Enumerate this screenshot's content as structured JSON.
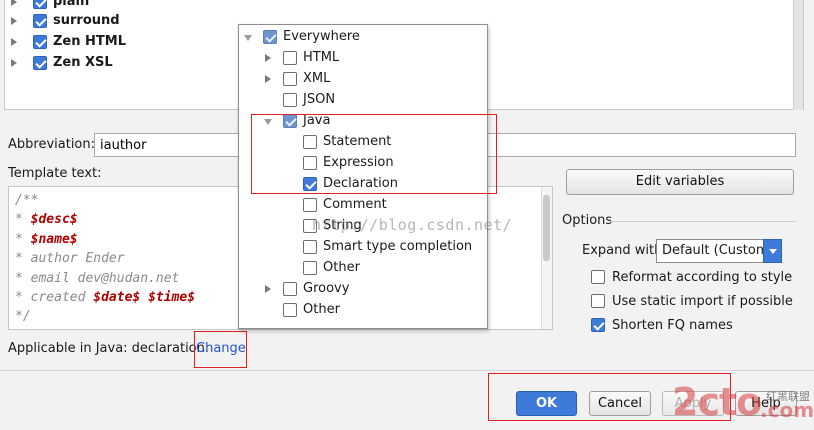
{
  "tree": {
    "items": [
      {
        "label": "plain",
        "checked": true
      },
      {
        "label": "surround",
        "checked": true
      },
      {
        "label": "Zen HTML",
        "checked": true
      },
      {
        "label": "Zen XSL",
        "checked": true
      }
    ]
  },
  "abbreviation": {
    "label": "Abbreviation:",
    "value": "iauthor"
  },
  "template": {
    "label": "Template text:",
    "lines": [
      {
        "prefix": "/**",
        "var": "",
        "rest": ""
      },
      {
        "prefix": " * ",
        "var": "$desc$",
        "rest": ""
      },
      {
        "prefix": " * ",
        "var": "$name$",
        "rest": ""
      },
      {
        "prefix": " * author Ender",
        "var": "",
        "rest": ""
      },
      {
        "prefix": " * email dev@hudan.net",
        "var": "",
        "rest": ""
      },
      {
        "prefix": " * created ",
        "var": "$date$",
        "rest": " $time$"
      },
      {
        "prefix": " */",
        "var": "",
        "rest": ""
      }
    ]
  },
  "applicable": {
    "text": "Applicable in Java: declaration.",
    "link": "Change"
  },
  "edit_variables": "Edit variables",
  "options": {
    "legend": "Options",
    "expand_label": "Expand with",
    "expand_value": "Default (Custom)",
    "reformat": {
      "label": "Reformat according to style",
      "checked": false
    },
    "static_import": {
      "label": "Use static import if possible",
      "checked": false
    },
    "shorten_fq": {
      "label": "Shorten FQ names",
      "checked": true
    }
  },
  "buttons": {
    "ok": "OK",
    "cancel": "Cancel",
    "apply": "Apply",
    "help": "Help"
  },
  "popup": {
    "everywhere": "Everywhere",
    "html": "HTML",
    "xml": "XML",
    "json": "JSON",
    "java": "Java",
    "statement": "Statement",
    "expression": "Expression",
    "declaration": "Declaration",
    "comment": "Comment",
    "string": "String",
    "smart_type": "Smart type completion",
    "other_java": "Other",
    "groovy": "Groovy",
    "other": "Other"
  },
  "watermark": "http://blog.csdn.net/",
  "logo": {
    "main": "2cto",
    "small": "红黑联盟",
    "com": ".com"
  }
}
